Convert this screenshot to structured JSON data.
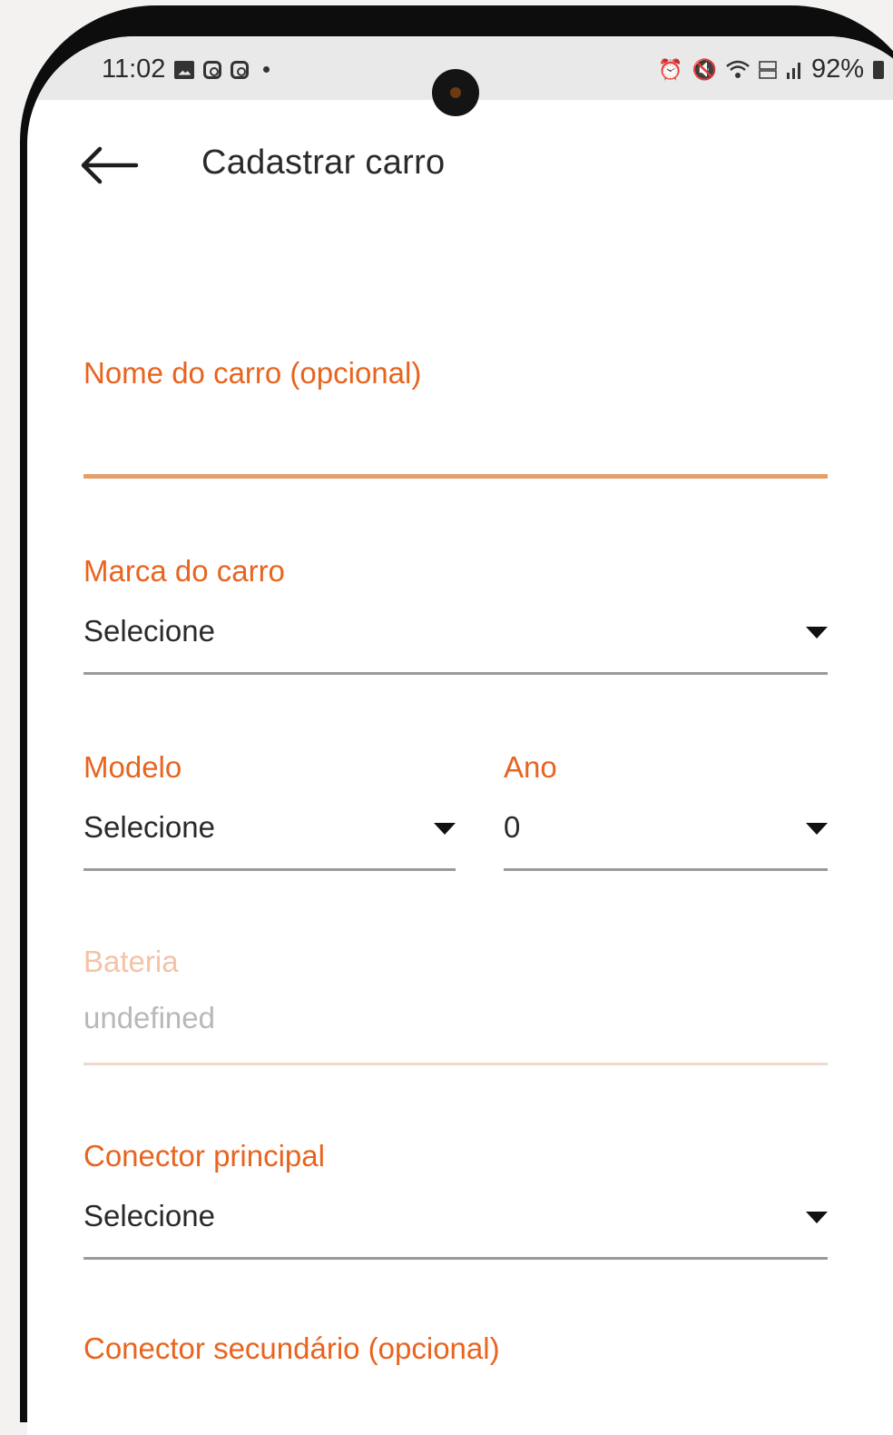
{
  "status_bar": {
    "time": "11:02",
    "left_icons": [
      "gallery-icon",
      "instagram-icon",
      "instagram-icon",
      "notification-dot-icon"
    ],
    "right_icons": [
      "alarm-icon",
      "mute-icon",
      "wifi-icon",
      "volte-icon",
      "signal-icon"
    ],
    "battery": "92%"
  },
  "app_bar": {
    "back_icon": "arrow-left-icon",
    "title": "Cadastrar carro"
  },
  "form": {
    "car_name": {
      "label": "Nome do carro (opcional)",
      "value": ""
    },
    "brand": {
      "label": "Marca do carro",
      "value": "Selecione"
    },
    "model": {
      "label": "Modelo",
      "value": "Selecione"
    },
    "year": {
      "label": "Ano",
      "value": "0"
    },
    "battery": {
      "label": "Bateria",
      "value": "undefined",
      "disabled": true
    },
    "main_connector": {
      "label": "Conector principal",
      "value": "Selecione"
    },
    "secondary_connector": {
      "label": "Conector secundário (opcional)"
    }
  },
  "colors": {
    "accent": "#e8641f",
    "focused_underline": "#e3a06c",
    "disabled_label": "#f5c2a6",
    "text": "#2a2a2a"
  }
}
